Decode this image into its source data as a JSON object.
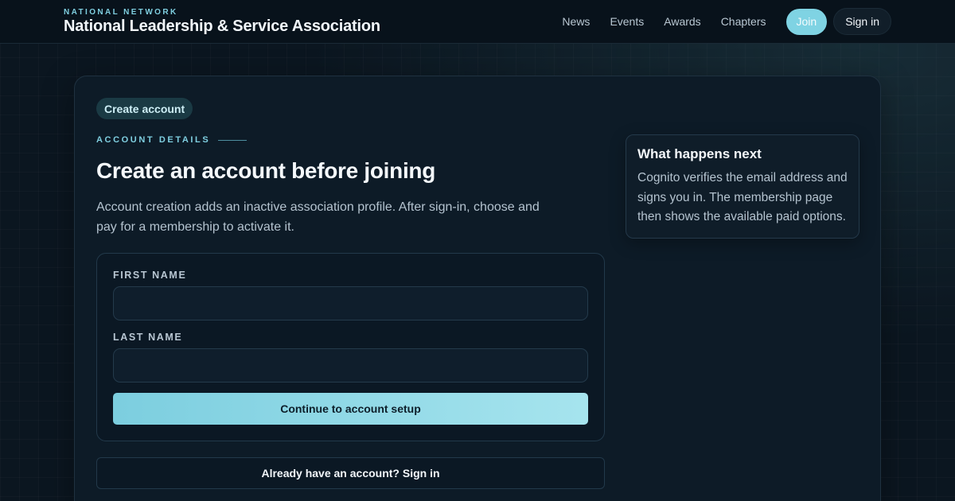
{
  "header": {
    "kicker": "NATIONAL NETWORK",
    "title": "National Leadership & Service Association",
    "nav": [
      "News",
      "Events",
      "Awards",
      "Chapters"
    ],
    "join_label": "Join",
    "signin_label": "Sign in"
  },
  "card": {
    "pill": "Create account",
    "eyebrow": "ACCOUNT DETAILS",
    "heading": "Create an account before joining",
    "intro": "Account creation adds an inactive association profile. After sign-in, choose and pay for a membership to activate it.",
    "form": {
      "first_name_label": "FIRST NAME",
      "first_name_value": "",
      "last_name_label": "LAST NAME",
      "last_name_value": "",
      "continue_label": "Continue to account setup"
    },
    "existing_account_label": "Already have an account? Sign in",
    "aside": {
      "title": "What happens next",
      "body": "Cognito verifies the email address and signs you in. The membership page then shows the available paid options."
    }
  },
  "colors": {
    "accent": "#7fd3e3",
    "background": "#0b1620",
    "card": "#0d1b27"
  }
}
